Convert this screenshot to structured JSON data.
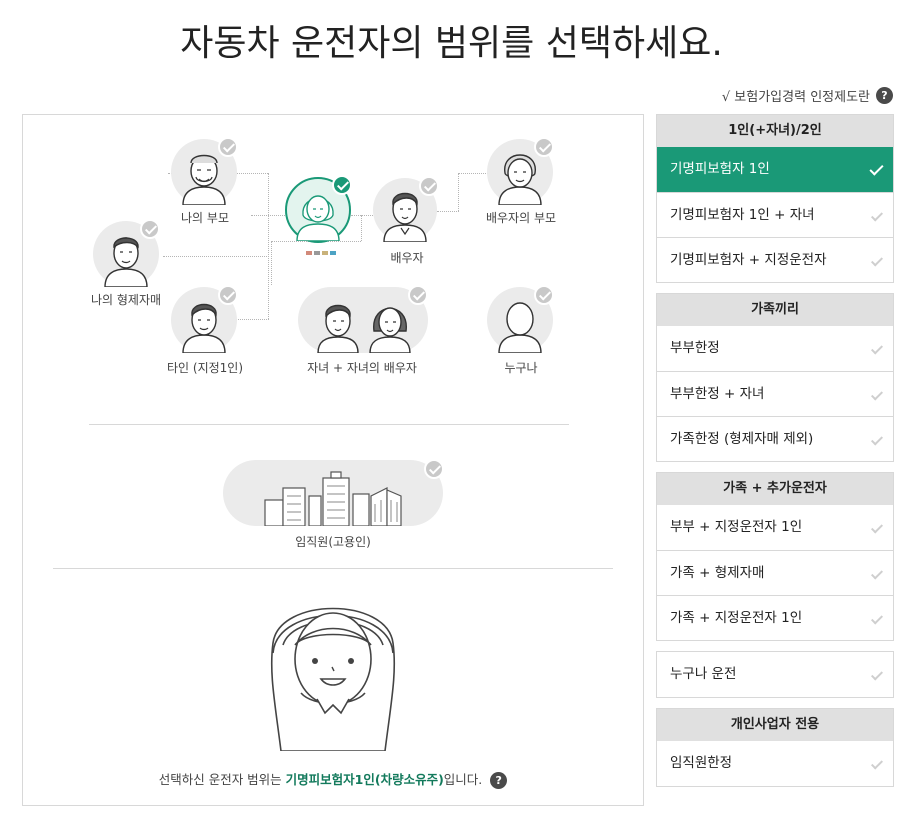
{
  "title": "자동차 운전자의 범위를 선택하세요.",
  "top_link": {
    "label": "√ 보험가입경력 인정제도란",
    "help": "?"
  },
  "nodes": {
    "parents": "나의 부모",
    "sibling": "나의 형제자매",
    "spouse": "배우자",
    "spouse_parents": "배우자의 부모",
    "other": "타인 (지정1인)",
    "children": "자녀 + 자녀의 배우자",
    "anyone": "누구나",
    "employee": "임직원(고용인)"
  },
  "summary": {
    "prefix": "선택하신 운전자 범위는 ",
    "value": "기명피보험자1인(차량소유주)",
    "suffix": "입니다.",
    "help": "?"
  },
  "groups": [
    {
      "header": "1인(+자녀)/2인",
      "options": [
        "기명피보험자 1인",
        "기명피보험자 1인 + 자녀",
        "기명피보험자 + 지정운전자"
      ]
    },
    {
      "header": "가족끼리",
      "options": [
        "부부한정",
        "부부한정 + 자녀",
        "가족한정 (형제자매 제외)"
      ]
    },
    {
      "header": "가족 + 추가운전자",
      "options": [
        "부부 + 지정운전자 1인",
        "가족 + 형제자매",
        "가족 + 지정운전자 1인"
      ]
    },
    {
      "header": "",
      "options": [
        "누구나 운전"
      ]
    },
    {
      "header": "개인사업자 전용",
      "options": [
        "임직원한정"
      ]
    }
  ],
  "selected_option": "기명피보험자 1인",
  "colors": {
    "accent": "#1a9977",
    "highlight_text": "#137a5c",
    "header_bg": "#e0e0e0",
    "avatar_bg": "#ebebeb"
  }
}
